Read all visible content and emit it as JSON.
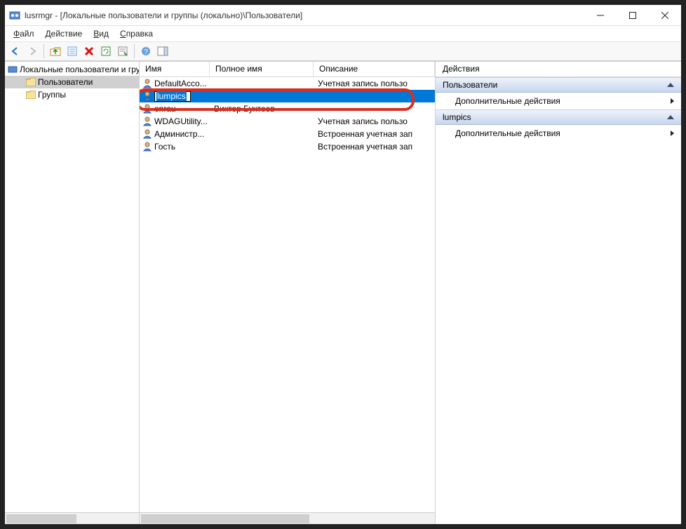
{
  "titlebar": {
    "title": "lusrmgr - [Локальные пользователи и группы (локально)\\Пользователи]"
  },
  "menu": {
    "file": "Файл",
    "action": "Действие",
    "view": "Вид",
    "help": "Справка"
  },
  "toolbar_icons": {
    "back": "back-icon",
    "forward": "forward-icon",
    "up": "up-folder-icon",
    "props": "properties-icon",
    "delete": "delete-icon",
    "refresh": "refresh-icon",
    "export": "export-list-icon",
    "help": "help-icon",
    "actions_panel": "actions-panel-icon"
  },
  "tree": {
    "root": "Локальные пользователи и группы",
    "nodes": [
      {
        "label": "Пользователи",
        "selected": true
      },
      {
        "label": "Группы",
        "selected": false
      }
    ]
  },
  "list": {
    "columns": {
      "name": "Имя",
      "full": "Полное имя",
      "desc": "Описание"
    },
    "rows": [
      {
        "name": "DefaultAcco...",
        "full": "",
        "desc": "Учетная запись пользо"
      },
      {
        "name": "lumpics",
        "full": "",
        "desc": "",
        "editing": true,
        "selected": true
      },
      {
        "name": "onrau",
        "full": "Виктор Бухтеев",
        "desc": ""
      },
      {
        "name": "WDAGUtility...",
        "full": "",
        "desc": "Учетная запись пользо"
      },
      {
        "name": "Администр...",
        "full": "",
        "desc": "Встроенная учетная зап"
      },
      {
        "name": "Гость",
        "full": "",
        "desc": "Встроенная учетная зап"
      }
    ]
  },
  "actions": {
    "title": "Действия",
    "sections": [
      {
        "header": "Пользователи",
        "items": [
          "Дополнительные действия"
        ]
      },
      {
        "header": "lumpics",
        "items": [
          "Дополнительные действия"
        ]
      }
    ]
  }
}
